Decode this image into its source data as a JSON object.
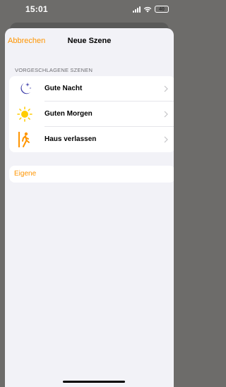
{
  "status_bar": {
    "time": "15:01",
    "battery": "40"
  },
  "nav": {
    "cancel_label": "Abbrechen",
    "title": "Neue Szene"
  },
  "suggested": {
    "header": "VORGESCHLAGENE SZENEN",
    "items": [
      {
        "label": "Gute Nacht",
        "icon": "moon-stars-icon"
      },
      {
        "label": "Guten Morgen",
        "icon": "sun-icon"
      },
      {
        "label": "Haus verlassen",
        "icon": "person-leaving-icon"
      }
    ]
  },
  "custom": {
    "label": "Eigene"
  },
  "colors": {
    "accent": "#ff9500",
    "moon": "#3a3aa8",
    "sun": "#ffcc00",
    "door": "#ff9500"
  }
}
